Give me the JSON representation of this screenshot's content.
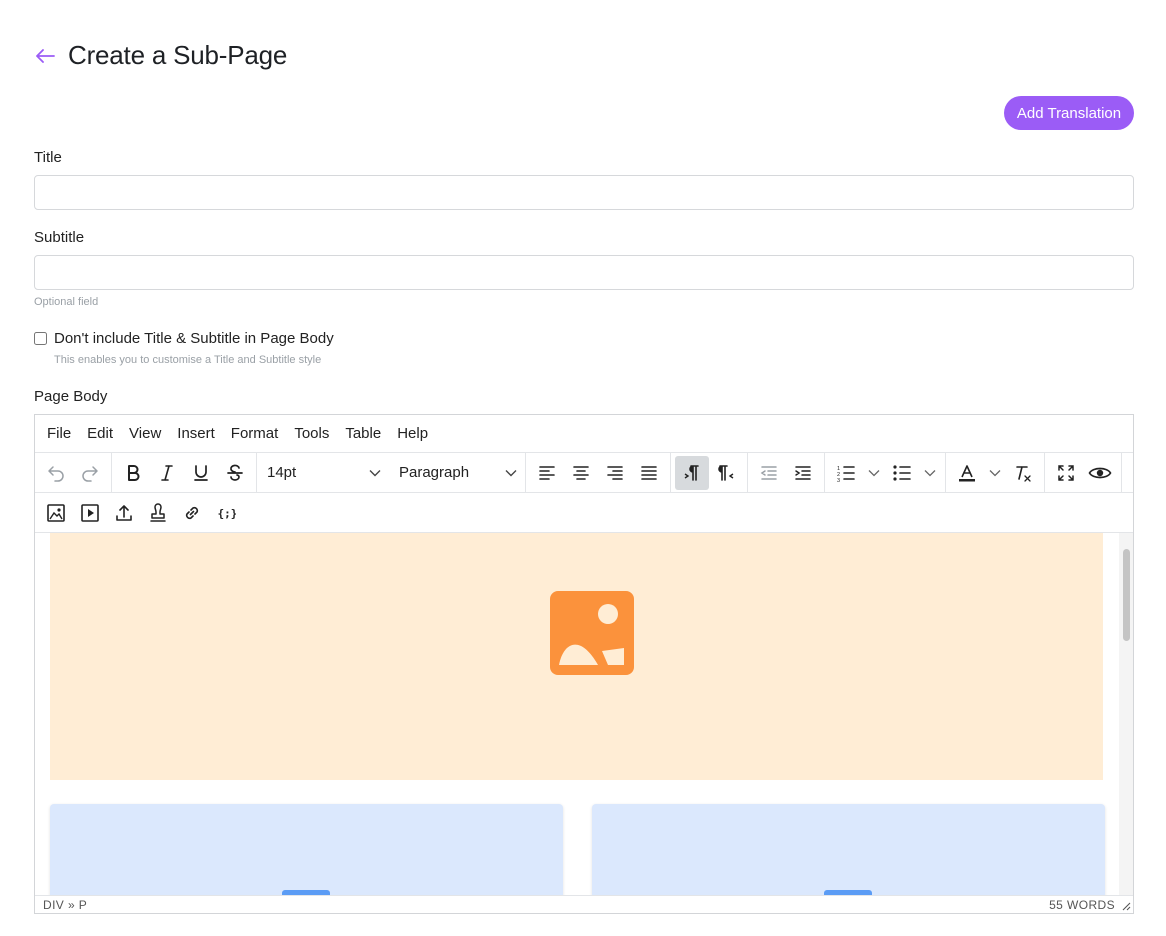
{
  "header": {
    "title": "Create a Sub-Page",
    "back_icon": "arrow-left-icon"
  },
  "actions": {
    "add_translation": "Add Translation"
  },
  "colors": {
    "accent": "#9b5cf6",
    "image_placeholder": "#ffedd5",
    "image_icon": "#fb923c",
    "card_placeholder": "#dbe8fd",
    "card_icon": "#5b9cf5"
  },
  "form": {
    "title": {
      "label": "Title",
      "value": ""
    },
    "subtitle": {
      "label": "Subtitle",
      "value": "",
      "helper": "Optional field"
    },
    "exclude_title": {
      "label": "Don't include Title & Subtitle in Page Body",
      "helper": "This enables you to customise a Title and Subtitle style",
      "checked": false
    },
    "page_body": {
      "label": "Page Body"
    }
  },
  "editor": {
    "menubar": [
      "File",
      "Edit",
      "View",
      "Insert",
      "Format",
      "Tools",
      "Table",
      "Help"
    ],
    "toolbar": {
      "font_size": "14pt",
      "block_format": "Paragraph",
      "icons_row1": [
        "undo-icon",
        "redo-icon",
        "bold-icon",
        "italic-icon",
        "underline-icon",
        "strikethrough-icon",
        "align-left-icon",
        "align-center-icon",
        "align-right-icon",
        "align-justify-icon",
        "ltr-icon",
        "rtl-icon",
        "outdent-icon",
        "indent-icon",
        "numbered-list-icon",
        "bullet-list-icon",
        "text-color-icon",
        "clear-formatting-icon",
        "fullscreen-icon",
        "preview-icon"
      ],
      "icons_row2": [
        "insert-image-icon",
        "insert-media-icon",
        "upload-icon",
        "stamp-icon",
        "link-icon",
        "code-variable-icon"
      ]
    },
    "status": {
      "path": "DIV » P",
      "word_count": "55 WORDS"
    }
  }
}
